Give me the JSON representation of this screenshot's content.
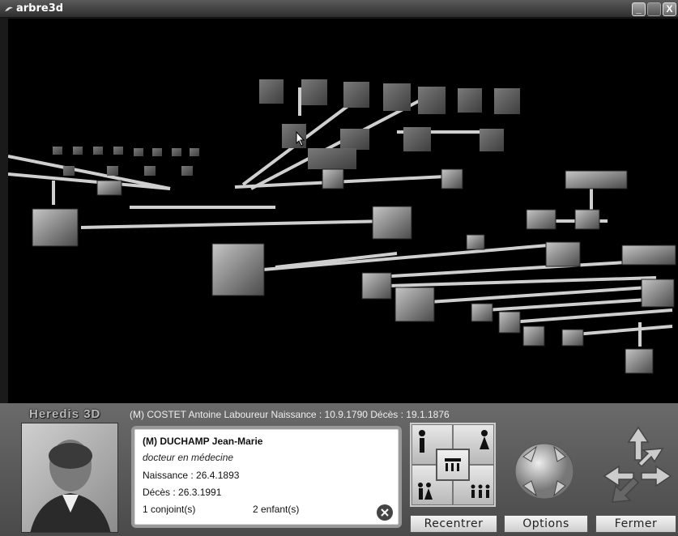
{
  "window": {
    "title": "arbre3d",
    "min_label": "_",
    "max_label": "",
    "close_label": "X"
  },
  "panel": {
    "logo": "Heredis 3D",
    "status_line": "(M) COSTET Antoine Laboureur Naissance : 10.9.1790 Décès : 19.1.1876",
    "person": {
      "name": "(M) DUCHAMP Jean-Marie",
      "occupation": "docteur en médecine",
      "birth": "Naissance : 26.4.1893",
      "death": "Décès : 26.3.1991",
      "spouses": "1 conjoint(s)",
      "children": "2 enfant(s)"
    },
    "buttons": {
      "recenter": "Recentrer",
      "options": "Options",
      "close": "Fermer"
    }
  },
  "colors": {
    "panel_bg": "#5a5a5a",
    "viewport_bg": "#000000",
    "card_bg": "#ffffff"
  },
  "icons": [
    "app-icon",
    "minimize-icon",
    "maximize-icon",
    "close-icon",
    "father-icon",
    "mother-icon",
    "family-icon",
    "couple-icon",
    "siblings-icon",
    "rotate-globe-icon",
    "move-arrows-icon",
    "close-card-icon"
  ]
}
